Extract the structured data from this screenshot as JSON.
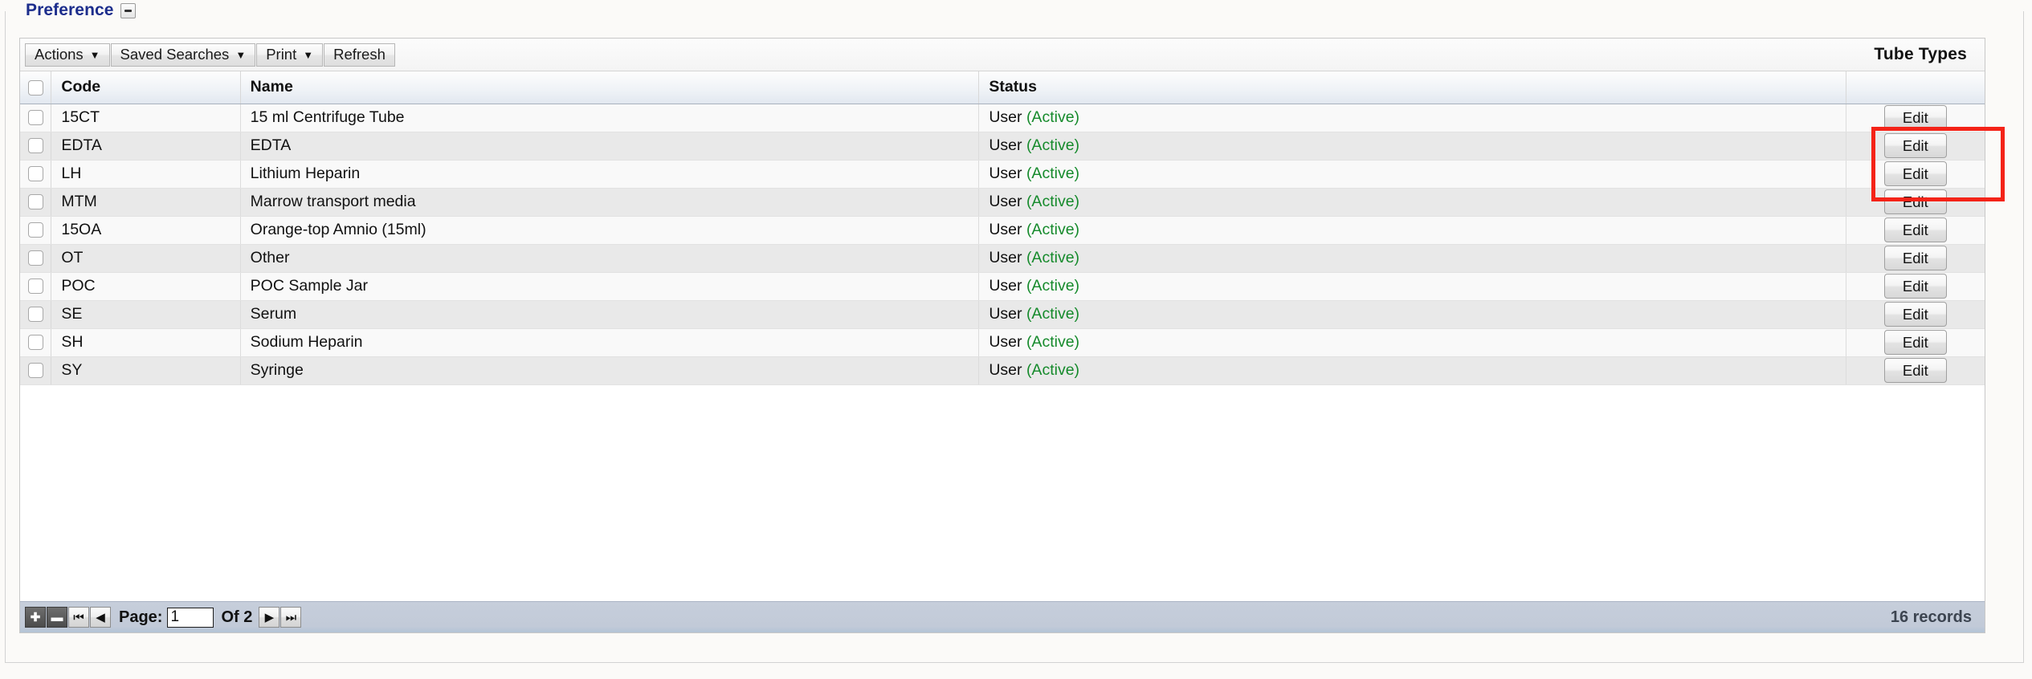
{
  "region": {
    "legend": "Preference",
    "collapse_icon": "minus-icon"
  },
  "toolbar": {
    "buttons": [
      {
        "label": "Actions",
        "caret": "▼",
        "has_caret": true
      },
      {
        "label": "Saved Searches",
        "caret": "▼",
        "has_caret": true
      },
      {
        "label": "Print",
        "caret": "▼",
        "has_caret": true
      },
      {
        "label": "Refresh",
        "caret": "",
        "has_caret": false
      }
    ],
    "title": "Tube Types"
  },
  "table": {
    "columns": [
      {
        "key": "check",
        "label": ""
      },
      {
        "key": "code",
        "label": "Code"
      },
      {
        "key": "name",
        "label": "Name"
      },
      {
        "key": "status",
        "label": "Status"
      },
      {
        "key": "edit",
        "label": ""
      }
    ],
    "edit_label": "Edit",
    "status_suffix": "(Active)",
    "rows": [
      {
        "code": "15CT",
        "name": "15 ml Centrifuge Tube",
        "status_owner": "User",
        "status_state": "(Active)",
        "edit": "Edit"
      },
      {
        "code": "EDTA",
        "name": "EDTA",
        "status_owner": "User",
        "status_state": "(Active)",
        "edit": "Edit"
      },
      {
        "code": "LH",
        "name": "Lithium Heparin",
        "status_owner": "User",
        "status_state": "(Active)",
        "edit": "Edit"
      },
      {
        "code": "MTM",
        "name": "Marrow transport media",
        "status_owner": "User",
        "status_state": "(Active)",
        "edit": "Edit"
      },
      {
        "code": "15OA",
        "name": "Orange-top Amnio (15ml)",
        "status_owner": "User",
        "status_state": "(Active)",
        "edit": "Edit"
      },
      {
        "code": "OT",
        "name": "Other",
        "status_owner": "User",
        "status_state": "(Active)",
        "edit": "Edit"
      },
      {
        "code": "POC",
        "name": "POC Sample Jar",
        "status_owner": "User",
        "status_state": "(Active)",
        "edit": "Edit"
      },
      {
        "code": "SE",
        "name": "Serum",
        "status_owner": "User",
        "status_state": "(Active)",
        "edit": "Edit"
      },
      {
        "code": "SH",
        "name": "Sodium Heparin",
        "status_owner": "User",
        "status_state": "(Active)",
        "edit": "Edit"
      },
      {
        "code": "SY",
        "name": "Syringe",
        "status_owner": "User",
        "status_state": "(Active)",
        "edit": "Edit"
      }
    ]
  },
  "pagination": {
    "add_icon": "plus-icon",
    "remove_icon": "minus-icon",
    "first_icon": "first-page-icon",
    "prev_icon": "previous-page-icon",
    "next_icon": "next-page-icon",
    "last_icon": "last-page-icon",
    "page_label": "Page:",
    "page_value": "1",
    "of_label": "Of 2",
    "records": "16 records"
  },
  "annotation": {
    "highlight_color": "#f42318",
    "target": "edit-button-row-1"
  },
  "colors": {
    "legend_text": "#1c2d8c",
    "status_active": "#158a2b",
    "footer_bg": "#c2cad8",
    "records_text": "#3c4450"
  }
}
